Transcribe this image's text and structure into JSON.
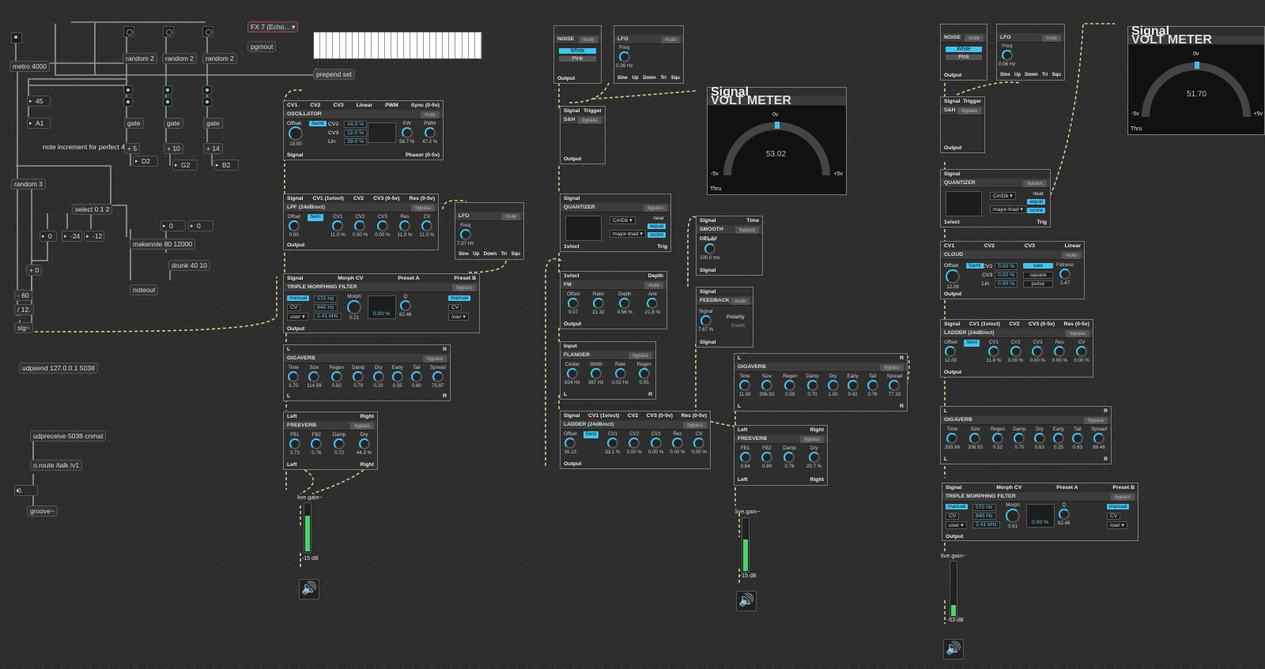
{
  "comments": {
    "note_inc": "note increment for perfect 4"
  },
  "objects": {
    "metro": "metro 4000",
    "r1": "random 2",
    "r2": "random 2",
    "r3": "random 2",
    "pgmout": "pgmout",
    "fxmenu": "FX 7 (Echo... ▾",
    "prepend": "prepend set",
    "n45": "45",
    "nA1": "A1",
    "gate1": "gate",
    "gate2": "gate",
    "gate3": "gate",
    "p5": "+ 5",
    "p10": "+ 10",
    "p14": "+ 14",
    "D2": "D2",
    "G2": "G2",
    "B2": "B2",
    "rand3": "random 3",
    "select": "select 0 1 2",
    "n0": "0",
    "n24": "-24",
    "n12": "-12",
    "makenote": "makenote 80 12000",
    "z1": "0",
    "z2": "0",
    "drunk": "drunk 40 10",
    "p0": "+ 0",
    "noteout": "noteout",
    "m60": "- 60",
    "d12": "/ 12.",
    "sig": "sig~",
    "udpsend": "udpsend 127.0.0.1 5038",
    "udprecv": "udpreceive 5038 cnmat",
    "oroute": "o.route /talk /v1",
    "n0b": "0.",
    "groove": "groove~",
    "livegain1": "live.gain~",
    "livegain2": "live.gain~",
    "livegain3": "live.gain~",
    "db1": "-15 dB",
    "db2": "-15 dB",
    "db3": "-53 dB"
  },
  "mods": {
    "osc": {
      "ports_top": [
        "CV1",
        "CV2",
        "CV3",
        "Linear",
        "PWM",
        "Sync (0-5v)"
      ],
      "title": "OSCILLATOR",
      "pill": "mute",
      "offset": "Offset",
      "semi": "Semi",
      "offset_val": "19.00",
      "cv2": "CV2",
      "cv3": "CV3",
      "lin": "Lin",
      "v1": "14.0 %",
      "v2": "12.0 %",
      "v3": "39.0 %",
      "pw": "PW",
      "pwm": "PWM",
      "pw_val": "58.7 %",
      "pwm_val": "47.2 %",
      "ports_bot": [
        "Signal",
        "Phasor (0-5v)"
      ]
    },
    "lpf": {
      "ports_top": [
        "Signal",
        "CV1 (1v/oct)",
        "CV2",
        "CV3 (0-5v)",
        "Res (0-5v)"
      ],
      "title": "LPF (24dB/oct)",
      "pill": "bypass",
      "knobs": [
        {
          "l": "Offset",
          "v": "0.00"
        },
        {
          "l": "CV1",
          "v": "11.0 %"
        },
        {
          "l": "CV2",
          "v": "0.00 %"
        },
        {
          "l": "CV3",
          "v": "0.00 %"
        },
        {
          "l": "Res",
          "v": "11.0 %"
        },
        {
          "l": "CV",
          "v": "11.0 %"
        }
      ],
      "semi": "Semi",
      "out": "Output"
    },
    "lfo1": {
      "title": "LFO",
      "pill": "mute",
      "freq": "Freq",
      "freq_val": "7.37 Hz",
      "shapes": [
        "Sine",
        "Up",
        "Down",
        "Tri",
        "Squ"
      ]
    },
    "tmf1": {
      "ports_top": [
        "Signal",
        "Morph CV",
        "Preset A",
        "Preset B"
      ],
      "title": "TRIPLE MORPHING FILTER",
      "pill": "bypass",
      "manual": "manual",
      "cv": "CV",
      "user": "user ▾",
      "f1": "570 Hz",
      "f2": "840 Hz",
      "f3": "2.41 kHz",
      "morph": "Morph",
      "morph_val": "0.21",
      "pct": "0.00 %",
      "q": "Q",
      "q_val": "62.46",
      "manual2": "manual",
      "cv2": "CV",
      "ow": "/ow/ ▾",
      "out": "Output"
    },
    "gv1": {
      "lr": [
        "L",
        "R"
      ],
      "title": "GIGAVERB",
      "pill": "bypass",
      "knobs": [
        {
          "l": "Time",
          "v": "3.70"
        },
        {
          "l": "Size",
          "v": "114.59"
        },
        {
          "l": "Regen",
          "v": "0.50"
        },
        {
          "l": "Damp",
          "v": "0.70"
        },
        {
          "l": "Dry",
          "v": "0.20"
        },
        {
          "l": "Early",
          "v": "0.55"
        },
        {
          "l": "Tail",
          "v": "0.60"
        },
        {
          "l": "Spread",
          "v": "70.87"
        }
      ]
    },
    "fv1": {
      "lr": [
        "Left",
        "Right"
      ],
      "title": "FREEVERB",
      "pill": "bypass",
      "knobs": [
        {
          "l": "FB1",
          "v": "0.73"
        },
        {
          "l": "FB2",
          "v": "0.76"
        },
        {
          "l": "Damp",
          "v": "0.72"
        },
        {
          "l": "Dry",
          "v": "44.3 %"
        }
      ]
    },
    "noise1": {
      "title": "NOISE",
      "pill": "mute",
      "white": "White",
      "pink": "Pink",
      "out": "Output"
    },
    "lfo2": {
      "title": "LFO",
      "pill": "mute",
      "freq": "Freq",
      "freq_val": "0.36 Hz",
      "shapes": [
        "Sine",
        "Up",
        "Down",
        "Tri",
        "Squ"
      ]
    },
    "sh1": {
      "ports": [
        "Signal",
        "Trigger"
      ],
      "title": "S&H",
      "pill": "bypass",
      "out": "Output"
    },
    "vu1": {
      "port": "Signal",
      "title": "VOLT METER",
      "zero": "0v",
      "val": "53.02",
      "neg": "-5v",
      "pos": "+5v",
      "thru": "Thru"
    },
    "q1": {
      "port": "Signal",
      "title": "QUANTIZER",
      "pill": "bypass",
      "key": "C#/Db ▾",
      "scale": "major-triad ▾",
      "near": "near",
      "equal": "equal",
      "score": "score",
      "ports_bot": [
        "1v/oct",
        "Trig"
      ]
    },
    "sd": {
      "ports": [
        "Signal",
        "Time"
      ],
      "title": "SMOOTH DELAY",
      "pill": "bypass",
      "time": "Time",
      "time_val": "100.0 ms",
      "out": "Signal"
    },
    "fm": {
      "ports": [
        "1v/oct",
        "Depth"
      ],
      "title": "FM",
      "pill": "mute",
      "knobs": [
        {
          "l": "Offset",
          "v": "9.07"
        },
        {
          "l": "Ratio",
          "v": "21.32"
        },
        {
          "l": "Depth",
          "v": "0.56 %"
        },
        {
          "l": "Amt",
          "v": "21.8 %"
        }
      ],
      "out": "Output"
    },
    "fb": {
      "port": "Signal",
      "title": "FEEDBACK",
      "pill": "mute",
      "signal": "Signal",
      "sig_val": "7.87 %",
      "polarity": "Polarity",
      "invert": "Invert",
      "out": "Signal"
    },
    "fl": {
      "port": "Input",
      "title": "FLANGER",
      "pill": "bypass",
      "knobs": [
        {
          "l": "Center",
          "v": "824 Hz"
        },
        {
          "l": "Width",
          "v": "387 Hz"
        },
        {
          "l": "Rate",
          "v": "0.02 Hz"
        },
        {
          "l": "Regen",
          "v": "0.55"
        }
      ],
      "lr": [
        "L",
        "R"
      ]
    },
    "gv2": {
      "lr": [
        "L",
        "R"
      ],
      "title": "GIGAVERB",
      "pill": "bypass",
      "knobs": [
        {
          "l": "Time",
          "v": "11.00"
        },
        {
          "l": "Size",
          "v": "206.93"
        },
        {
          "l": "Regen",
          "v": "0.59"
        },
        {
          "l": "Damp",
          "v": "0.70"
        },
        {
          "l": "Dry",
          "v": "1.00"
        },
        {
          "l": "Early",
          "v": "0.42"
        },
        {
          "l": "Tail",
          "v": "0.76"
        },
        {
          "l": "Spread",
          "v": "77.33"
        }
      ]
    },
    "ld1": {
      "ports_top": [
        "Signal",
        "CV1 (1v/oct)",
        "CV2",
        "CV3 (0-5v)",
        "Res (0-5v)"
      ],
      "title": "LADDER (24dB/oct)",
      "pill": "bypass",
      "semi": "Semi",
      "knobs": [
        {
          "l": "Offset",
          "v": "16.13"
        },
        {
          "l": "CV1",
          "v": "33.1 %"
        },
        {
          "l": "CV2",
          "v": "0.00 %"
        },
        {
          "l": "CV3",
          "v": "0.00 %"
        },
        {
          "l": "Res",
          "v": "0.00 %"
        },
        {
          "l": "CV",
          "v": "0.00 %"
        }
      ],
      "out": "Output"
    },
    "fv2": {
      "lr": [
        "Left",
        "Right"
      ],
      "title": "FREEVERB",
      "pill": "bypass",
      "knobs": [
        {
          "l": "FB1",
          "v": "0.64"
        },
        {
          "l": "FB2",
          "v": "0.89"
        },
        {
          "l": "Damp",
          "v": "0.78"
        },
        {
          "l": "Dry",
          "v": "20.7 %"
        }
      ]
    },
    "noise2": {
      "title": "NOISE",
      "pill": "mute",
      "white": "White",
      "pink": "Pink",
      "out": "Output"
    },
    "lfo3": {
      "title": "LFO",
      "pill": "mute",
      "freq": "Freq",
      "freq_val": "0.06 Hz",
      "shapes": [
        "Sine",
        "Up",
        "Down",
        "Tri",
        "Squ"
      ]
    },
    "vu2": {
      "port": "Signal",
      "title": "VOLT METER",
      "zero": "0v",
      "val": "51.70",
      "neg": "-5v",
      "pos": "+5v",
      "thru": "Thru"
    },
    "sh2": {
      "ports": [
        "Signal",
        "Trigger"
      ],
      "title": "S&H",
      "pill": "bypass",
      "out": "Output"
    },
    "q2": {
      "port": "Signal",
      "title": "QUANTIZER",
      "pill": "bypass",
      "key": "C#/Db ▾",
      "scale": "major-triad ▾",
      "near": "near",
      "equal": "equal",
      "score": "score",
      "ports_bot": [
        "1v/oct",
        "Trig"
      ]
    },
    "cloud": {
      "ports_top": [
        "CV1",
        "CV2",
        "CV3",
        "Linear"
      ],
      "title": "CLOUD",
      "pill": "mute",
      "offset": "Offset",
      "semi": "Semi",
      "offset_val": "12.09",
      "cv2": "CV2",
      "cv3": "CV3",
      "lin": "Lin",
      "v": "0.00 %",
      "saw": "saw",
      "square": "square",
      "pulse": "pulse",
      "fatness": "Fatness",
      "fat_val": "2.47",
      "out": "Output"
    },
    "ld2": {
      "ports_top": [
        "Signal",
        "CV1 (1v/oct)",
        "CV2",
        "CV3 (0-5v)",
        "Res (0-5v)"
      ],
      "title": "LADDER (24dB/oct)",
      "pill": "bypass",
      "semi": "Semi",
      "knobs": [
        {
          "l": "Offset",
          "v": "12.00"
        },
        {
          "l": "CV1",
          "v": "11.8 %"
        },
        {
          "l": "CV2",
          "v": "0.00 %"
        },
        {
          "l": "CV3",
          "v": "0.00 %"
        },
        {
          "l": "Res",
          "v": "0.00 %"
        },
        {
          "l": "CV",
          "v": "0.00 %"
        }
      ],
      "out": "Output"
    },
    "gv3": {
      "lr": [
        "L",
        "R"
      ],
      "title": "GIGAVERB",
      "pill": "bypass",
      "knobs": [
        {
          "l": "Time",
          "v": "393.98"
        },
        {
          "l": "Size",
          "v": "206.93"
        },
        {
          "l": "Regen",
          "v": "0.52"
        },
        {
          "l": "Damp",
          "v": "0.70"
        },
        {
          "l": "Dry",
          "v": "0.63"
        },
        {
          "l": "Early",
          "v": "0.25"
        },
        {
          "l": "Tail",
          "v": "0.63"
        },
        {
          "l": "Spread",
          "v": "69.46"
        }
      ]
    },
    "tmf2": {
      "ports_top": [
        "Signal",
        "Morph CV",
        "Preset A",
        "Preset B"
      ],
      "title": "TRIPLE MORPHING FILTER",
      "pill": "bypass",
      "manual": "manual",
      "cv": "CV",
      "user": "user ▾",
      "f1": "570 Hz",
      "f2": "840 Hz",
      "f3": "2.41 kHz",
      "morph": "Morph",
      "morph_val": "0.61",
      "pct": "0.00 %",
      "q": "Q",
      "q_val": "62.46",
      "manual2": "manual",
      "cv2": "CV",
      "ow": "/ow/ ▾",
      "out": "Output"
    }
  },
  "colors": {
    "accent": "#43c3ef",
    "wire": "#c9c99a",
    "meter": "#49d36b"
  }
}
